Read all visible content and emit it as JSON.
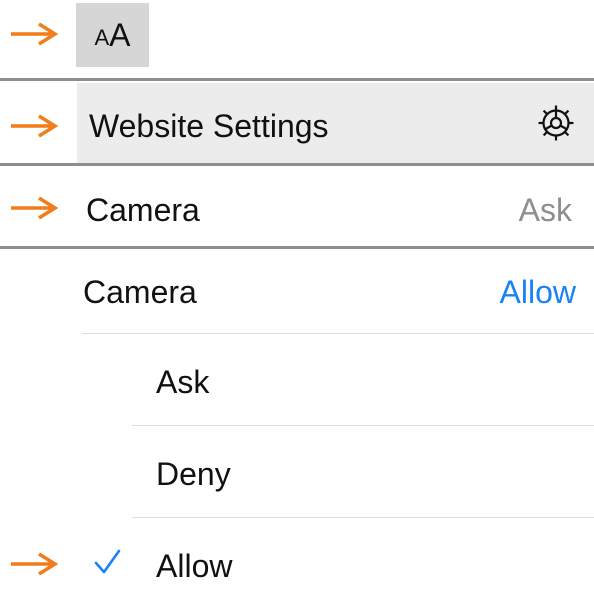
{
  "colors": {
    "arrow": "#f07c1c",
    "accent_blue": "#1a82f7",
    "secondary_gray": "#8e8e8e",
    "highlight_bg": "#ececec",
    "aa_bg": "#d6d6d6"
  },
  "icons": {
    "arrow": "arrow-right-icon",
    "gear": "gear-icon",
    "check": "checkmark-icon"
  },
  "toolbar": {
    "aa_small": "A",
    "aa_large": "A"
  },
  "website_settings": {
    "label": "Website Settings"
  },
  "camera_ask": {
    "label": "Camera",
    "value": "Ask"
  },
  "camera_permission": {
    "label": "Camera",
    "value": "Allow",
    "options": [
      "Ask",
      "Deny",
      "Allow"
    ],
    "selected": "Allow"
  }
}
